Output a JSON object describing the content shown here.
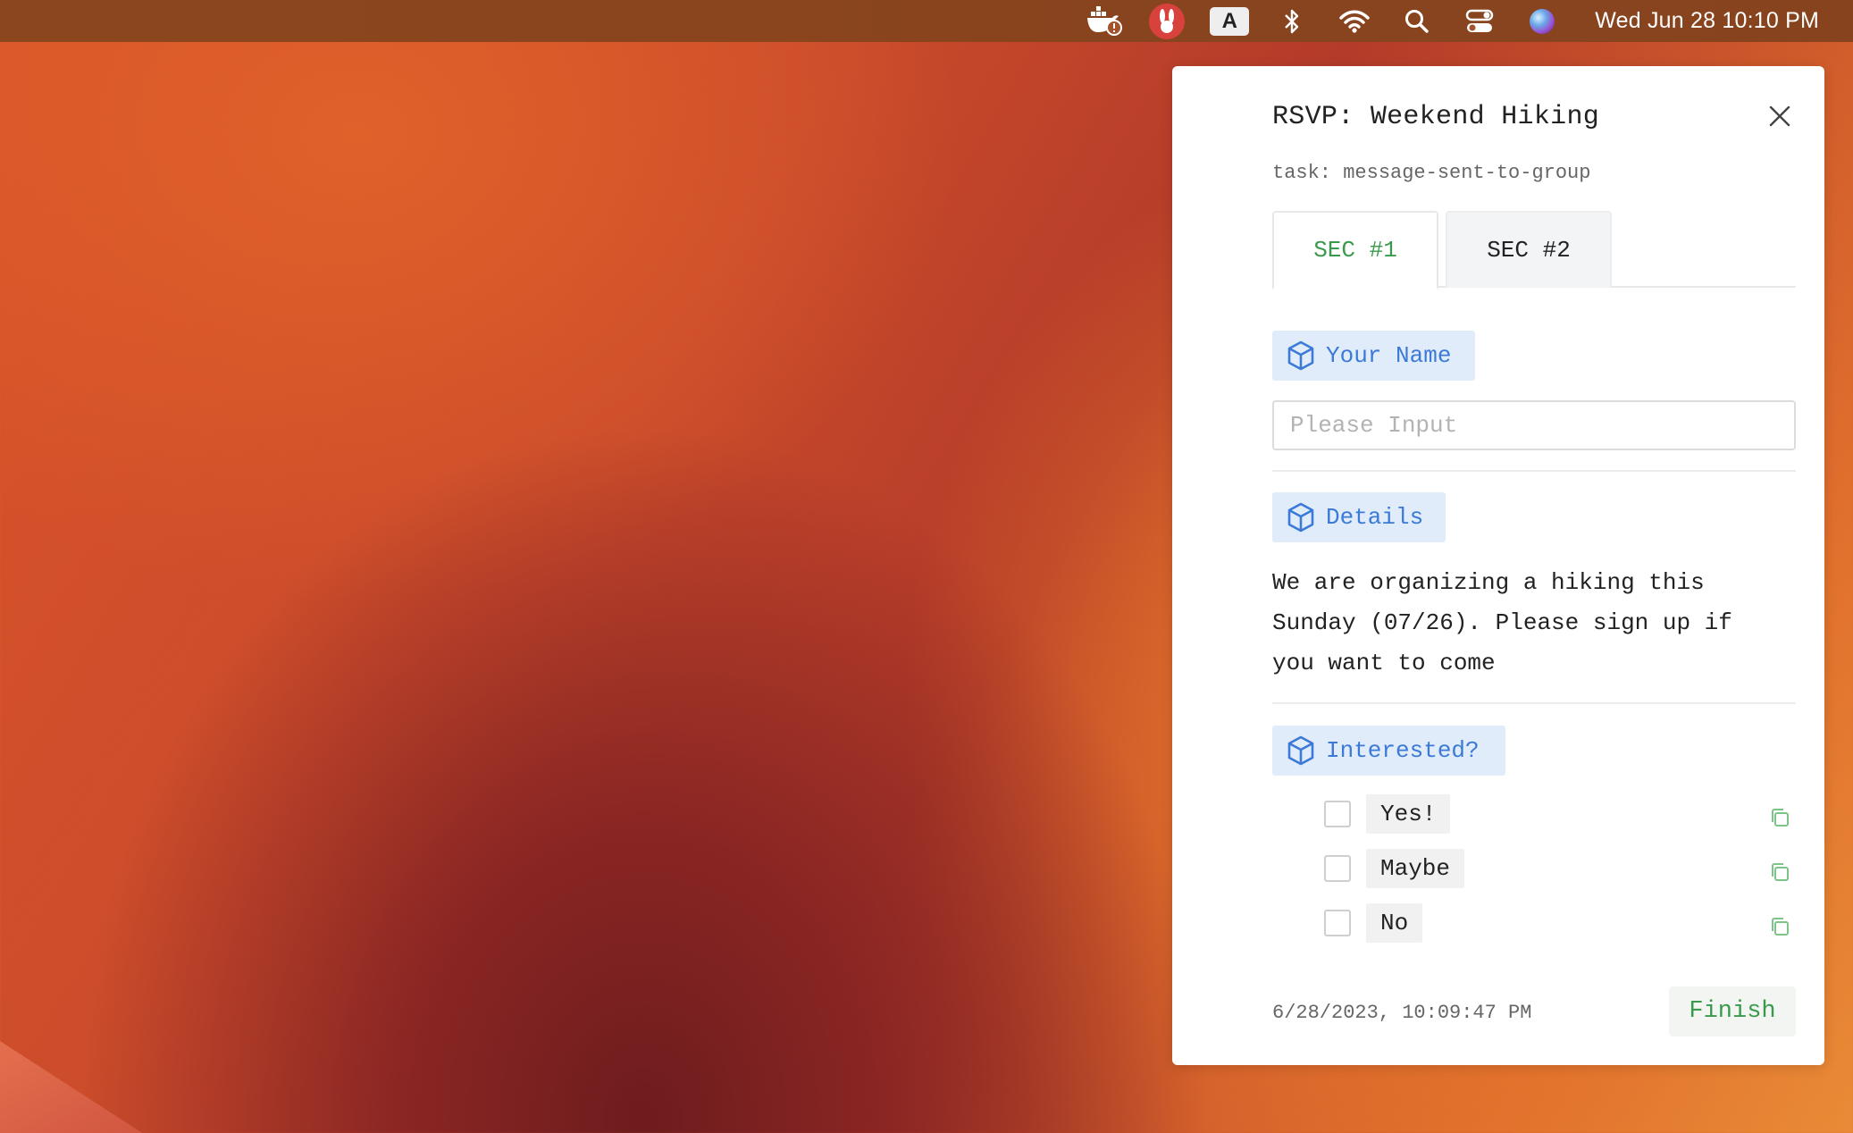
{
  "menubar": {
    "icons": [
      "docker-alert-icon",
      "rabbit-app-icon",
      "input-source-icon",
      "bluetooth-icon",
      "wifi-icon",
      "spotlight-search-icon",
      "control-center-icon",
      "siri-icon"
    ],
    "input_source_letter": "A",
    "clock": "Wed Jun 28  10:10 PM"
  },
  "panel": {
    "title": "RSVP: Weekend Hiking",
    "task": "task: message-sent-to-group",
    "tabs": [
      {
        "label": "SEC #1",
        "active": true
      },
      {
        "label": "SEC #2",
        "active": false
      }
    ],
    "name_section": {
      "label": "Your Name",
      "placeholder": "Please Input",
      "value": ""
    },
    "details_section": {
      "label": "Details",
      "text": "We are organizing a hiking this\nSunday (07/26). Please sign up if\nyou want to come"
    },
    "interested_section": {
      "label": "Interested?",
      "options": [
        {
          "label": "Yes!",
          "checked": false
        },
        {
          "label": "Maybe",
          "checked": false
        },
        {
          "label": "No",
          "checked": false
        }
      ]
    },
    "timestamp": "6/28/2023, 10:09:47 PM",
    "finish_label": "Finish"
  },
  "colors": {
    "accent_green": "#3a9a4c",
    "tag_blue": "#3b7ad6",
    "tag_bg": "#e1ecfb"
  }
}
